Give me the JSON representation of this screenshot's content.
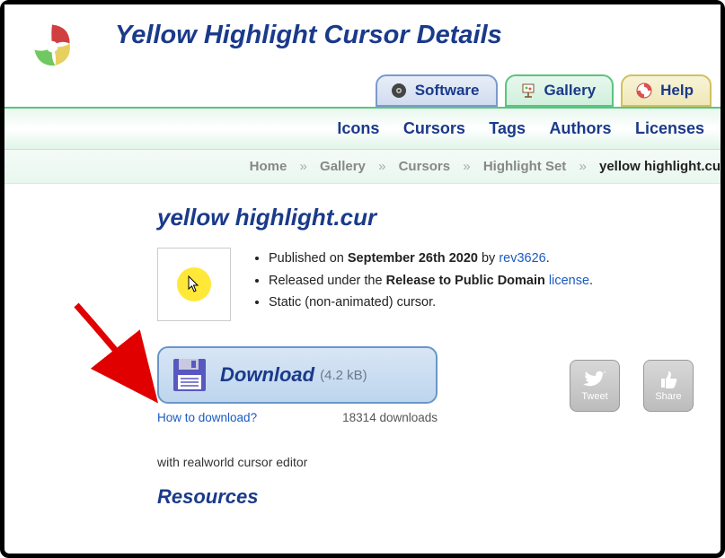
{
  "page_title": "Yellow Highlight Cursor Details",
  "tabs": {
    "software": "Software",
    "gallery": "Gallery",
    "help": "Help"
  },
  "subnav": {
    "icons": "Icons",
    "cursors": "Cursors",
    "tags": "Tags",
    "authors": "Authors",
    "licenses": "Licenses"
  },
  "breadcrumb": {
    "home": "Home",
    "gallery": "Gallery",
    "cursors": "Cursors",
    "set": "Highlight Set",
    "current": "yellow highlight.cu"
  },
  "cursor": {
    "title": "yellow highlight.cur",
    "published_prefix": "Published on ",
    "published_date": "September 26th 2020",
    "published_by": " by ",
    "author": "rev3626",
    "released_prefix": "Released under the ",
    "license_name": "Release to Public Domain",
    "license_link": "license",
    "static_note": "Static (non-animated) cursor."
  },
  "download": {
    "label": "Download",
    "size": "(4.2 kB)",
    "how_to": "How to download?",
    "count": "18314 downloads"
  },
  "social": {
    "tweet": "Tweet",
    "share": "Share"
  },
  "editor_note": "with realworld cursor editor",
  "resources_heading": "Resources"
}
